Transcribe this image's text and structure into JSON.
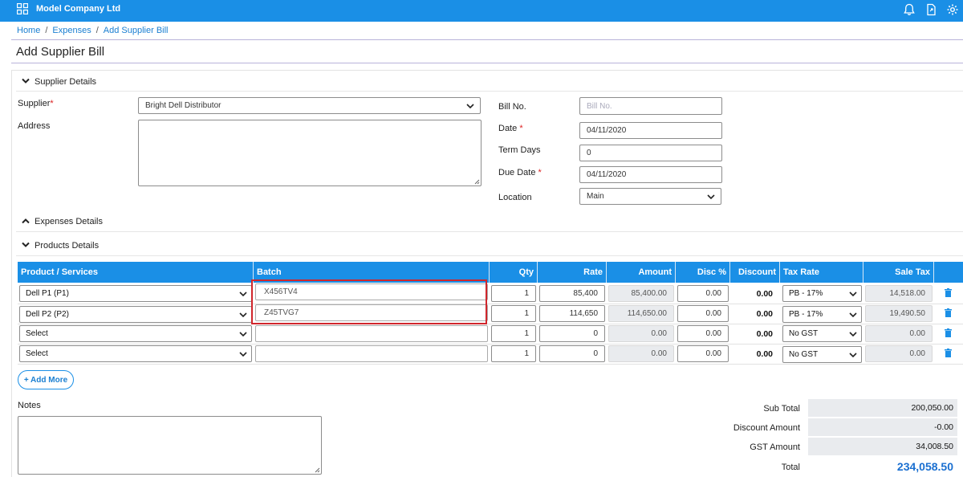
{
  "app": {
    "company": "Model Company Ltd"
  },
  "breadcrumb": {
    "home": "Home",
    "expenses": "Expenses",
    "current": "Add Supplier Bill",
    "sep": "/"
  },
  "page": {
    "title": "Add Supplier Bill"
  },
  "sections": {
    "supplier": "Supplier Details",
    "expenses": "Expenses Details",
    "products": "Products Details"
  },
  "supplier_form": {
    "supplier_label": "Supplier",
    "required_mark": "*",
    "supplier_value": "Bright Dell Distributor",
    "address_label": "Address",
    "bill_no_label": "Bill No.",
    "bill_no_placeholder": "Bill No.",
    "date_label": "Date",
    "date_value": "04/11/2020",
    "term_days_label": "Term Days",
    "term_days_value": "0",
    "due_date_label": "Due Date",
    "due_date_value": "04/11/2020",
    "location_label": "Location",
    "location_value": "Main"
  },
  "table": {
    "headers": {
      "product": "Product / Services",
      "batch": "Batch",
      "qty": "Qty",
      "rate": "Rate",
      "amount": "Amount",
      "disc_pct": "Disc %",
      "discount": "Discount",
      "tax_rate": "Tax Rate",
      "sale_tax": "Sale Tax"
    },
    "rows": [
      {
        "product": "Dell P1 (P1)",
        "batch": "X456TV4",
        "qty": "1",
        "rate": "85,400",
        "amount": "85,400.00",
        "disc_pct": "0.00",
        "discount": "0.00",
        "tax_rate": "PB - 17%",
        "sale_tax": "14,518.00"
      },
      {
        "product": "Dell P2 (P2)",
        "batch": "Z45TVG7",
        "qty": "1",
        "rate": "114,650",
        "amount": "114,650.00",
        "disc_pct": "0.00",
        "discount": "0.00",
        "tax_rate": "PB - 17%",
        "sale_tax": "19,490.50"
      },
      {
        "product": "Select",
        "batch": "",
        "qty": "1",
        "rate": "0",
        "amount": "0.00",
        "disc_pct": "0.00",
        "discount": "0.00",
        "tax_rate": "No GST",
        "sale_tax": "0.00"
      },
      {
        "product": "Select",
        "batch": "",
        "qty": "1",
        "rate": "0",
        "amount": "0.00",
        "disc_pct": "0.00",
        "discount": "0.00",
        "tax_rate": "No GST",
        "sale_tax": "0.00"
      }
    ]
  },
  "actions": {
    "add_more": "+ Add More"
  },
  "notes": {
    "label": "Notes"
  },
  "totals": {
    "sub_total_label": "Sub Total",
    "sub_total": "200,050.00",
    "discount_label": "Discount Amount",
    "discount": "-0.00",
    "gst_label": "GST Amount",
    "gst": "34,008.50",
    "total_label": "Total",
    "total": "234,058.50"
  },
  "colors": {
    "accent": "#1a8fe6",
    "highlight": "#d0262c",
    "total": "#1a6fd0"
  },
  "icons": {
    "menu": "apps-grid-icon",
    "bell": "bell-icon",
    "export": "file-export-icon",
    "settings": "gear-icon",
    "delete": "trash-icon",
    "chevron": "chevron-down-icon"
  }
}
